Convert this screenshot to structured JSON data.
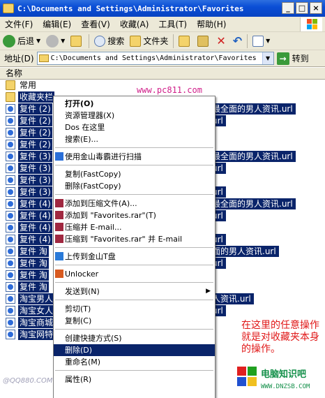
{
  "window": {
    "title": "C:\\Documents and Settings\\Administrator\\Favorites"
  },
  "window_buttons": [
    "_",
    "□",
    "×"
  ],
  "menubar": [
    "文件(F)",
    "编辑(E)",
    "查看(V)",
    "收藏(A)",
    "工具(T)",
    "帮助(H)"
  ],
  "toolbar": {
    "back": "后退",
    "search": "搜索",
    "folders": "文件夹"
  },
  "address": {
    "label": "地址(D)",
    "value": "C:\\Documents and Settings\\Administrator\\Favorites",
    "go": "转到"
  },
  "list_header": "名称",
  "files": [
    {
      "name": "常用",
      "icon": "folder-icon",
      "selected": false
    },
    {
      "name": "收藏夹栏",
      "icon": "folder-icon",
      "selected": true
    },
    {
      "name": "复件 (2)",
      "icon": "url-icon",
      "selected": true
    },
    {
      "name": "复件 (2)",
      "icon": "url-icon",
      "selected": true
    },
    {
      "name": "复件 (2)",
      "icon": "url-icon",
      "selected": true
    },
    {
      "name": "复件 (2)",
      "icon": "url-icon",
      "selected": true
    },
    {
      "name": "复件 (3)",
      "icon": "url-icon",
      "selected": true
    },
    {
      "name": "复件 (3)",
      "icon": "url-icon",
      "selected": true
    },
    {
      "name": "复件 (3)",
      "icon": "url-icon",
      "selected": true
    },
    {
      "name": "复件 (3)",
      "icon": "url-icon",
      "selected": true
    },
    {
      "name": "复件 (4)",
      "icon": "url-icon",
      "selected": true
    },
    {
      "name": "复件 (4)",
      "icon": "url-icon",
      "selected": true
    },
    {
      "name": "复件 (4)",
      "icon": "url-icon",
      "selected": true
    },
    {
      "name": "复件 (4)",
      "icon": "url-icon",
      "selected": true
    },
    {
      "name": "复件 淘",
      "icon": "url-icon",
      "selected": true
    },
    {
      "name": "复件 淘",
      "icon": "url-icon",
      "selected": true
    },
    {
      "name": "复件 淘",
      "icon": "url-icon",
      "selected": true
    },
    {
      "name": "复件 淘",
      "icon": "url-icon",
      "selected": true
    },
    {
      "name": "淘宝男人",
      "icon": "url-icon",
      "selected": true
    },
    {
      "name": "淘宝女人",
      "icon": "url-icon",
      "selected": true
    },
    {
      "name": "淘宝商城",
      "icon": "url-icon",
      "selected": true
    },
    {
      "name": "淘宝网特",
      "icon": "url-icon",
      "selected": true
    }
  ],
  "visible_tails": [
    {
      "row": 2,
      "text": "最全面的男人资讯.url"
    },
    {
      "row": 3,
      "text": "url"
    },
    {
      "row": 6,
      "text": "最全面的男人资讯.url"
    },
    {
      "row": 7,
      "text": "url"
    },
    {
      "row": 9,
      "text": "url"
    },
    {
      "row": 10,
      "text": "最全面的男人资讯.url"
    },
    {
      "row": 11,
      "text": "url"
    },
    {
      "row": 13,
      "text": "url"
    },
    {
      "row": 14,
      "text": "面的男人资讯.url"
    },
    {
      "row": 15,
      "text": "url"
    },
    {
      "row": 18,
      "text": "人资讯.url"
    },
    {
      "row": 19,
      "text": "url"
    }
  ],
  "context_menu": [
    {
      "label": "打开(O)",
      "bold": true
    },
    {
      "label": "资源管理器(X)"
    },
    {
      "label": "Dos 在这里"
    },
    {
      "label": "搜索(E)..."
    },
    {
      "sep": true
    },
    {
      "label": "使用金山毒霸进行扫描",
      "icon": "shield-icon"
    },
    {
      "sep": true
    },
    {
      "label": "复制(FastCopy)"
    },
    {
      "label": "删除(FastCopy)"
    },
    {
      "sep": true
    },
    {
      "label": "添加到压缩文件(A)...",
      "icon": "archive-icon"
    },
    {
      "label": "添加到 \"Favorites.rar\"(T)",
      "icon": "archive-icon"
    },
    {
      "label": "压缩并 E-mail...",
      "icon": "archive-icon"
    },
    {
      "label": "压缩到 \"Favorites.rar\" 并 E-mail",
      "icon": "archive-icon"
    },
    {
      "sep": true
    },
    {
      "label": "上传到金山T盘",
      "icon": "upload-icon"
    },
    {
      "sep": true
    },
    {
      "label": "Unlocker",
      "icon": "unlocker-icon"
    },
    {
      "sep": true
    },
    {
      "label": "发送到(N)",
      "submenu": true
    },
    {
      "sep": true
    },
    {
      "label": "剪切(T)"
    },
    {
      "label": "复制(C)"
    },
    {
      "sep": true
    },
    {
      "label": "创建快捷方式(S)"
    },
    {
      "label": "删除(D)",
      "highlighted": true
    },
    {
      "label": "重命名(M)"
    },
    {
      "sep": true
    },
    {
      "label": "属性(R)"
    }
  ],
  "watermark_top": "www.pc811.com",
  "annotation": "在这里的任意操作就是对收藏夹本身的操作。",
  "logo": {
    "title": "电脑知识吧",
    "url": "WWW.DNZSB.COM"
  },
  "watermark_bottom": "@QQ880.COM"
}
